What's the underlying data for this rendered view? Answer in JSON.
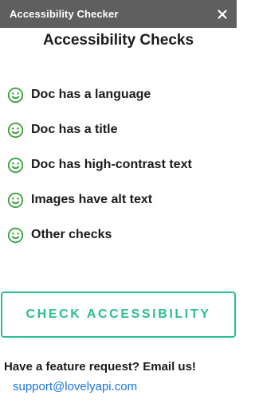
{
  "window": {
    "title": "Accessibility Checker",
    "close_icon": "close-icon"
  },
  "heading": "Accessibility Checks",
  "checks": [
    {
      "label": "Doc has a language",
      "icon": "smiley-icon",
      "status_color": "#2e9e2e"
    },
    {
      "label": "Doc has a title",
      "icon": "smiley-icon",
      "status_color": "#2e9e2e"
    },
    {
      "label": "Doc has high-contrast text",
      "icon": "smiley-icon",
      "status_color": "#2e9e2e"
    },
    {
      "label": "Images have alt text",
      "icon": "smiley-icon",
      "status_color": "#2e9e2e"
    },
    {
      "label": "Other checks",
      "icon": "smiley-icon",
      "status_color": "#2e9e2e"
    }
  ],
  "actions": {
    "check_button_label": "CHECK ACCESSIBILITY",
    "accent_color": "#2bbf8e"
  },
  "footer": {
    "feature_request_text": "Have a feature request? Email us!",
    "support_email": "support@lovelyapi.com",
    "link_color": "#1a73e8"
  }
}
